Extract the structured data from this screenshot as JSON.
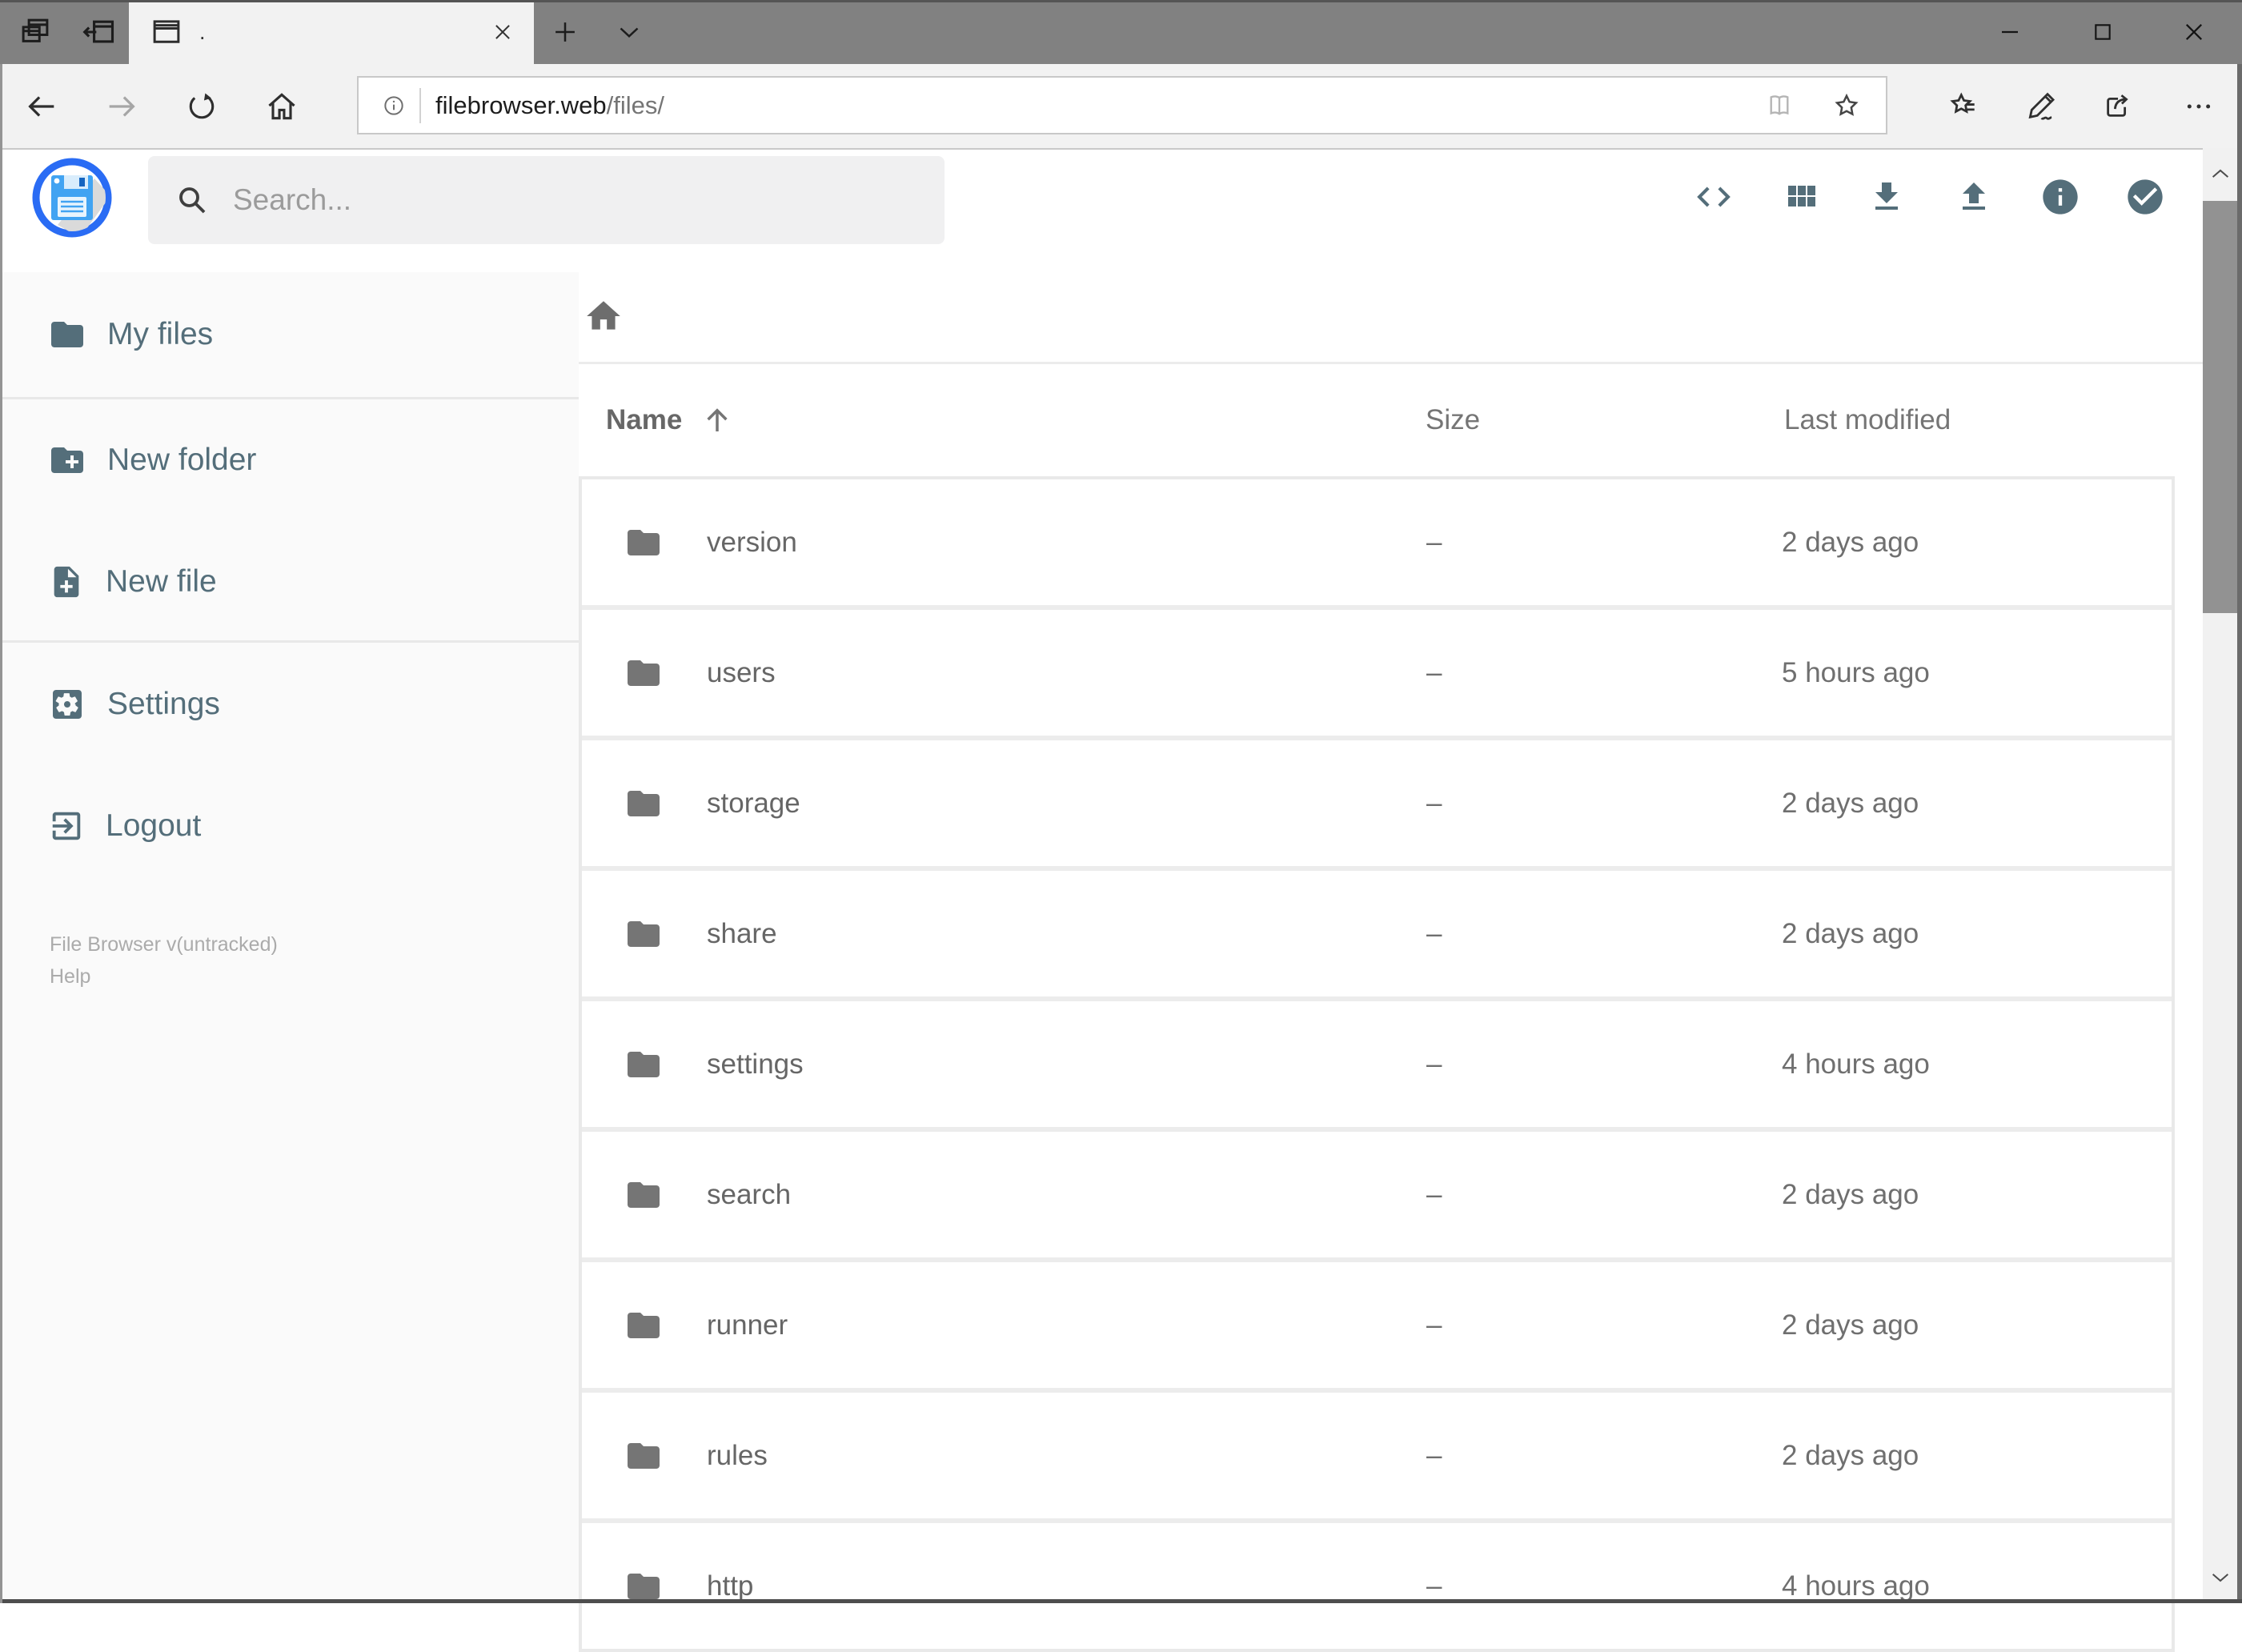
{
  "browser": {
    "tab_title": ".",
    "url_host": "filebrowser.web",
    "url_path": "/files/"
  },
  "app": {
    "search_placeholder": "Search...",
    "sidebar": {
      "items": [
        {
          "label": "My files",
          "icon": "folder-icon"
        },
        {
          "label": "New folder",
          "icon": "new-folder-icon"
        },
        {
          "label": "New file",
          "icon": "new-file-icon"
        },
        {
          "label": "Settings",
          "icon": "settings-icon"
        },
        {
          "label": "Logout",
          "icon": "logout-icon"
        }
      ],
      "footer_line1": "File Browser v(untracked)",
      "footer_line2": "Help"
    },
    "listing": {
      "columns": {
        "name": "Name",
        "size": "Size",
        "modified": "Last modified"
      },
      "sort": "name ascending",
      "rows": [
        {
          "name": "version",
          "size": "–",
          "modified": "2 days ago"
        },
        {
          "name": "users",
          "size": "–",
          "modified": "5 hours ago"
        },
        {
          "name": "storage",
          "size": "–",
          "modified": "2 days ago"
        },
        {
          "name": "share",
          "size": "–",
          "modified": "2 days ago"
        },
        {
          "name": "settings",
          "size": "–",
          "modified": "4 hours ago"
        },
        {
          "name": "search",
          "size": "–",
          "modified": "2 days ago"
        },
        {
          "name": "runner",
          "size": "–",
          "modified": "2 days ago"
        },
        {
          "name": "rules",
          "size": "–",
          "modified": "2 days ago"
        },
        {
          "name": "http",
          "size": "–",
          "modified": "4 hours ago"
        }
      ]
    },
    "colors": {
      "accent_slate": "#546e7a",
      "logo_ring_blue": "#2a6cf4",
      "floppy_blue": "#41a3f2",
      "chrome_gray": "#818181",
      "toolbar_gray": "#f2f2f2"
    }
  }
}
